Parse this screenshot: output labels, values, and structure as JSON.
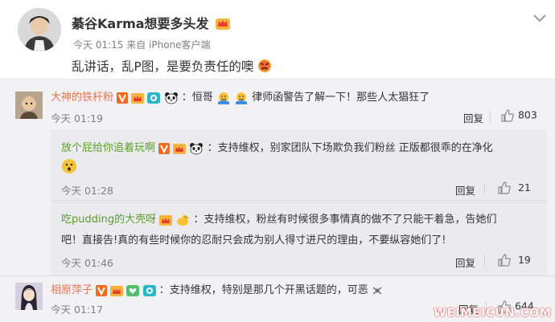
{
  "post": {
    "username": "綦谷Karma想要多头发",
    "time": "今天 01:15",
    "source": "来自 iPhone客户端",
    "text": "乱讲话，乱P图，是要负责任的噢"
  },
  "comments": [
    {
      "username": "大神的铁杆粉",
      "text_before": "：恒哥",
      "text_after": "律师函警告了解一下！那些人太猖狂了",
      "time": "今天 01:19",
      "reply_label": "回复",
      "likes": "803"
    },
    {
      "username": "放个屁给你追着玩啊",
      "text": "：支持维权，别家团队下场欺负我们粉丝  正版都很乖的在净化",
      "time": "今天 01:28",
      "reply_label": "回复",
      "likes": "21"
    },
    {
      "username": "吃pudding的大壳呀",
      "text_line1": "：支持维权，粉丝有时候很多事情真的做不了只能干着急，告她们",
      "text_line2": "吧！直接告!真的有些时候你的忍耐只会成为别人得寸进尺的理由，不要纵容她们了!",
      "time": "今天 01:46",
      "reply_label": "回复",
      "likes": "19"
    },
    {
      "username": "相原萍子",
      "text": "：支持维权，特别是那几个开黑话题的，可恶",
      "time": "今天 01:17",
      "reply_label": "回复",
      "likes": "644"
    }
  ],
  "watermark": "WEIMEICUN.COM",
  "colors": {
    "username_orange": "#eb7350",
    "username_green": "#5b9e2b",
    "meta_gray": "#808080"
  }
}
